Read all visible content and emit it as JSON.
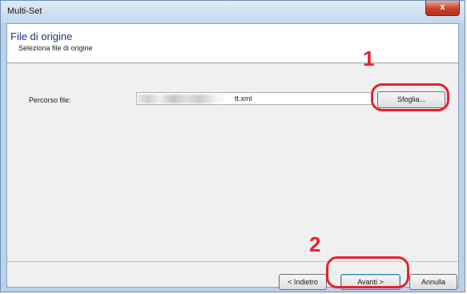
{
  "window": {
    "title": "Multi-Set",
    "close_glyph": "x"
  },
  "header": {
    "title": "File di origine",
    "subtitle": "Seleziona file di origine"
  },
  "form": {
    "path_label": "Percorso file:",
    "path_value": "tt.xml",
    "browse_label": "Sfoglia..."
  },
  "footer": {
    "back_label": "< Indietro",
    "next_label": "Avanti >",
    "cancel_label": "Annulla"
  },
  "annotations": {
    "step1": "1",
    "step2": "2",
    "color": "#e8202f"
  }
}
